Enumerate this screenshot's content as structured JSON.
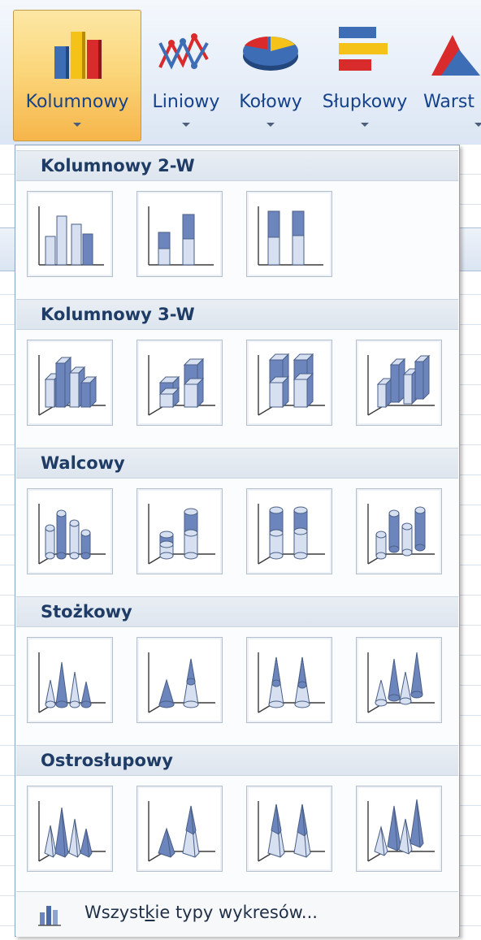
{
  "ribbon": {
    "buttons": [
      {
        "label": "Kolumnowy",
        "icon": "column-chart-icon",
        "active": true
      },
      {
        "label": "Liniowy",
        "icon": "line-chart-icon"
      },
      {
        "label": "Kołowy",
        "icon": "pie-chart-icon"
      },
      {
        "label": "Słupkowy",
        "icon": "bar-chart-icon"
      },
      {
        "label": "Warst",
        "icon": "area-chart-icon"
      }
    ]
  },
  "gallery": {
    "sections": [
      {
        "title": "Kolumnowy 2-W",
        "count": 3,
        "shape": "column2d"
      },
      {
        "title": "Kolumnowy 3-W",
        "count": 4,
        "shape": "column3d"
      },
      {
        "title": "Walcowy",
        "count": 4,
        "shape": "cylinder"
      },
      {
        "title": "Stożkowy",
        "count": 4,
        "shape": "cone"
      },
      {
        "title": "Ostrosłupowy",
        "count": 4,
        "shape": "pyramid"
      }
    ],
    "footer": {
      "pre": "Wszyst",
      "underlined": "k",
      "post": "ie typy wykresów...",
      "icon": "all-chart-types-icon"
    }
  },
  "colors": {
    "accent_active": "#f6b54a",
    "label_text": "#15428b",
    "chart_fill_dark": "#6c86bd",
    "chart_fill_light": "#d6e0f1"
  }
}
